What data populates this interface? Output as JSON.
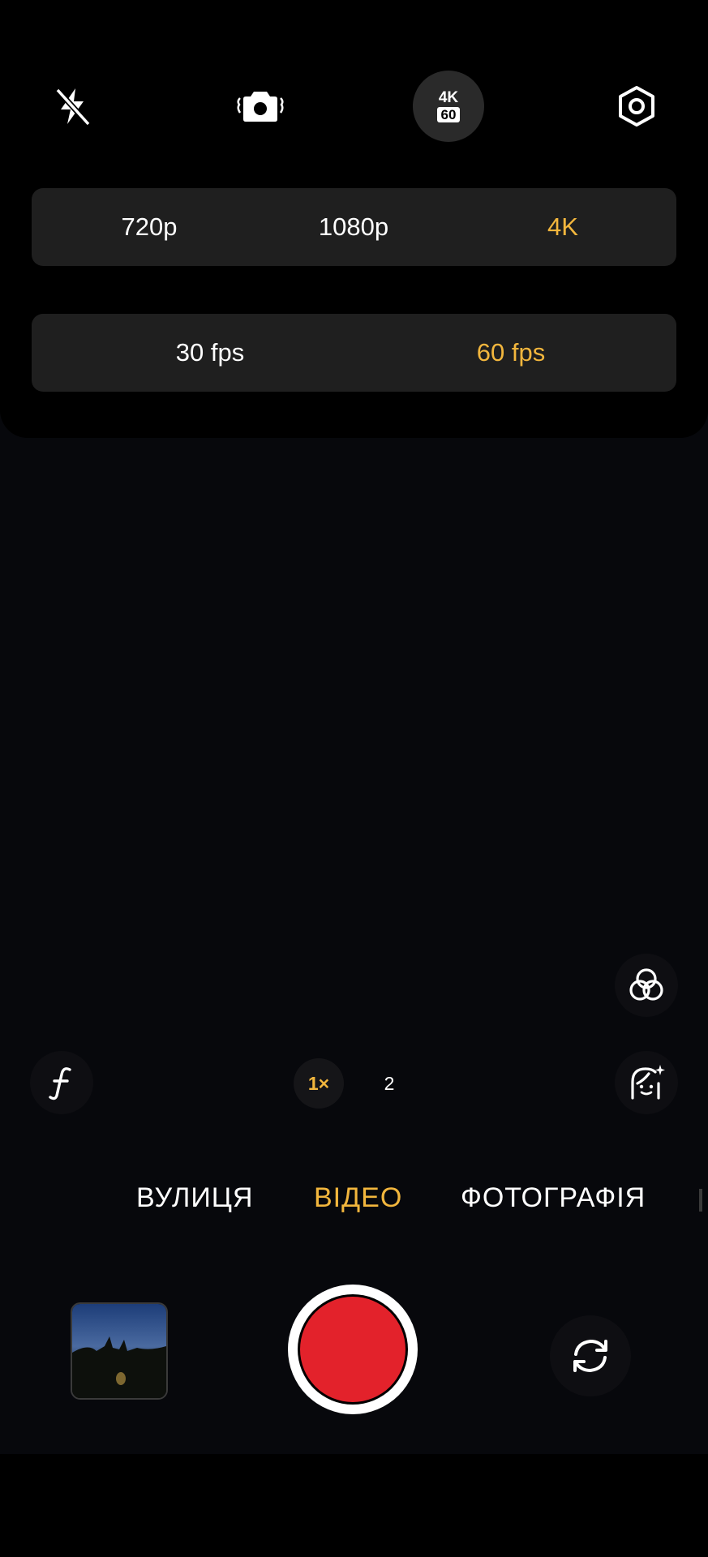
{
  "top_bar": {
    "flash_icon": "flash-off-icon",
    "stabilization_icon": "camera-stabilization-icon",
    "resolution_badge": {
      "line1": "4K",
      "line2": "60"
    },
    "settings_icon": "settings-hex-icon"
  },
  "resolution_selector": {
    "options": [
      "720p",
      "1080p",
      "4K"
    ],
    "selected": "4K"
  },
  "fps_selector": {
    "options": [
      "30 fps",
      "60 fps"
    ],
    "selected": "60 fps"
  },
  "side_controls": {
    "filters_icon": "filters-icon",
    "film_icon": "film-f-icon",
    "portrait_effect_icon": "face-sparkle-icon"
  },
  "zoom": {
    "options": [
      "1×",
      "2"
    ],
    "selected": "1×"
  },
  "modes": {
    "items": [
      "ВУЛИЦЯ",
      "ВІДЕО",
      "ФОТОГРАФІЯ"
    ],
    "selected": "ВІДЕО"
  },
  "bottom": {
    "gallery_thumbnail": "gallery-thumbnail",
    "record_icon": "record-button",
    "switch_camera_icon": "switch-camera-icon"
  },
  "colors": {
    "accent": "#f2b63d",
    "record": "#e3222b",
    "panel": "#1f1f1f"
  }
}
